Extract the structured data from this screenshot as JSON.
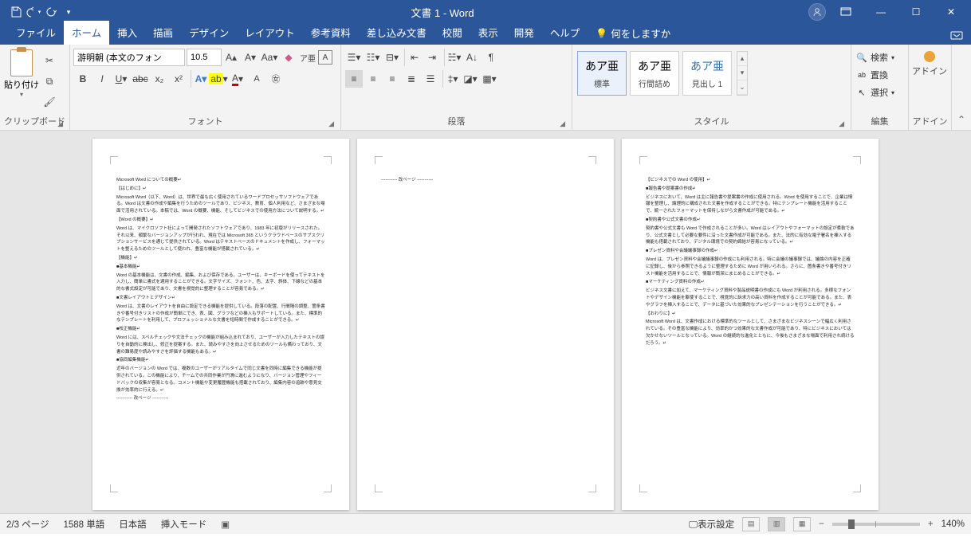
{
  "titlebar": {
    "title": "文書 1 - Word",
    "qat": {
      "save": "save",
      "undo": "undo",
      "redo": "redo",
      "customize": "customize"
    },
    "window": {
      "min": "—",
      "max": "☐",
      "close": "✕",
      "ribbon_mode": "▭"
    }
  },
  "tabs": {
    "file": "ファイル",
    "home": "ホーム",
    "insert": "挿入",
    "draw": "描画",
    "design": "デザイン",
    "layout": "レイアウト",
    "references": "参考資料",
    "mailings": "差し込み文書",
    "review": "校閲",
    "view": "表示",
    "developer": "開発",
    "help": "ヘルプ",
    "tellme": "何をしますか"
  },
  "ribbon": {
    "clipboard": {
      "label": "クリップボード",
      "paste": "貼り付け"
    },
    "font": {
      "label": "フォント",
      "name": "游明朝 (本文のフォン",
      "size": "10.5"
    },
    "paragraph": {
      "label": "段落"
    },
    "styles": {
      "label": "スタイル",
      "preview": "あア亜",
      "items": [
        {
          "name": "標準",
          "sel": true
        },
        {
          "name": "行間詰め",
          "sel": false
        },
        {
          "name": "見出し 1",
          "sel": false
        }
      ]
    },
    "editing": {
      "label": "編集",
      "find": "検索",
      "replace": "置換",
      "select": "選択"
    },
    "addin": {
      "label": "アドイン",
      "button": "アドイン"
    }
  },
  "doc": {
    "page1": [
      "Microsoft Word についての概要↵",
      "【はじめに】↵",
      "Microsoft Word（以下、Word）は、世界で最も広く使用されているワードプロセッサソフトウェアである。Word は文書の作成や編集を行うためのツールであり、ビジネス、教育、個人利用など、さまざまな場面で活用されている。本稿では、Word の概要、機能、そしてビジネスでの使用方法について説明する。↵",
      "【Word の概要】↵",
      "Word は、マイクロソフト社によって開発されたソフトウェアであり、1983 年に初版がリリースされた。それ以来、頻繁なバージョンアップが行われ、現在では Microsoft 365 というクラウドベースのサブスクリプションサービスを通じて提供されている。Word はテキストベースのドキュメントを作成し、フォーマットを整えるためのツールとして使われ、豊富な機能が搭載されている。↵",
      "【機能】↵",
      "■基本機能↵",
      "Word の基本機能は、文書の作成、編集、および保存である。ユーザーは、キーボードを使ってテキストを入力し、簡単に書式を適用することができる。文字サイズ、フォント、色、太字、斜体、下線などの基本的な書式設定が可能であり、文書を視覚的に整理することが容易である。↵",
      "■文書レイアウトとデザイン↵",
      "Word は、文書のレイアウトを自由に設定できる機能を提供している。段落の配置、行間隔の調整、箇条書きや番号付きリストの作成が簡単にでき、表、図、グラフなどの挿入もサポートしている。また、標準的なテンプレートを利用して、プロフェッショナルな文書を短時間で作成することができる。↵",
      "■校正機能↵",
      "Word には、スペルチェックや文法チェックの機能が組み込まれており、ユーザーが入力したテキストの誤りを自動的に検出し、修正を提案する。また、読みやすさを向上させるためのツールも備わっており、文書の難易度や読みやすさを評価する機能もある。↵",
      "■協同編集機能↵",
      "近年のバージョンの Word では、複数のユーザーがリアルタイムで同じ文書を同時に編集できる機能が提供されている。この機能により、チームでの共同作業が円滑に進むようになり、バージョン管理やフィードバックの収集が容易となる。コメント機能や変更履歴機能も搭載されており、編集内容の追跡や意見交換が効率的に行える。↵",
      "----------- 改ページ -----------"
    ],
    "page2": [
      "----------- 改ページ -----------"
    ],
    "page3": [
      "【ビジネスでの Word の使用】↵",
      "■報告書や提案書の作成↵",
      "ビジネスにおいて、Word は主に報告書や提案書の作成に使用される。Word を使用することで、企業は情報を整理し、論理的に構成された文書を作成することができる。特にテンプレート機能を活用することで、統一されたフォーマットを保持しながら文書作成が可能である。↵",
      "■契約書や公式文書の作成↵",
      "契約書や公式文書も Word で作成されることが多い。Word はレイアウトやフォーマットの設定が柔軟であり、公式文書として必要な要件に沿った文書作成が可能である。また、法的に有効な電子署名を挿入する機能も搭載されており、デジタル環境での契約締結が容易になっている。↵",
      "■プレゼン資料や会議議事録の作成↵",
      "Word は、プレゼン資料や会議議事録の作成にも利用される。特に会議の議事録では、議論の内容を正確に記録し、後から参照できるように整理するために Word が用いられる。さらに、箇条書きや番号付きリスト機能を活用することで、情報が簡潔にまとめることができる。↵",
      "■マーケティング資料の作成↵",
      "ビジネス文書に加えて、マーケティング資料や製品説明書の作成にも Word が利用される。多様なフォントやデザイン機能を駆使することで、視覚的に訴求力の高い資料を作成することが可能である。また、表やグラフを挿入することで、データに基づいた効果的なプレゼンテーションを行うことができる。↵",
      "【おわりに】↵",
      "Microsoft Word は、文書作成における標準的なツールとして、さまざまなビジネスシーンで幅広く利用されている。その豊富な機能により、効率的かつ効果的な文書作成が可能であり、特にビジネスにおいては欠かせないツールとなっている。Word の継続的な進化とともに、今後もさまざまな場面で利用され続けるだろう。↵"
    ]
  },
  "status": {
    "page": "2/3 ページ",
    "words": "1588 単語",
    "lang": "日本語",
    "mode": "挿入モード",
    "display": "表示設定",
    "zoom": "140%"
  }
}
